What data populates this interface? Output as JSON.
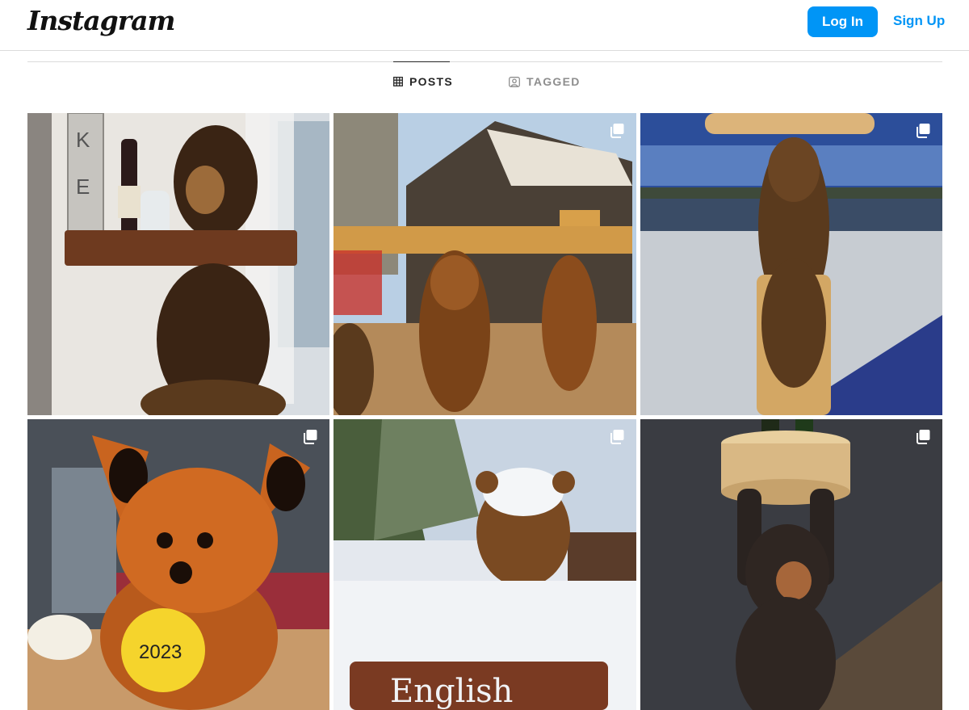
{
  "header": {
    "logo_text": "Instagram",
    "login_label": "Log In",
    "signup_label": "Sign Up",
    "accent_color": "#0095f6"
  },
  "tabs": [
    {
      "label": "POSTS",
      "icon": "grid-icon",
      "active": true
    },
    {
      "label": "TAGGED",
      "icon": "tagged-person-icon",
      "active": false
    }
  ],
  "posts": [
    {
      "subject": "carved bear holding wooden shelf with wine bottle",
      "multi": false,
      "wall_text": "AKE"
    },
    {
      "subject": "two carved bears supporting a log bar counter",
      "multi": true
    },
    {
      "subject": "carved bear on post holding moose-shaped sign by frozen lake",
      "multi": true
    },
    {
      "subject": "carved fox holding yellow 2023 volleyball",
      "multi": true,
      "ball_text": "2023"
    },
    {
      "subject": "snow covered carved bear above sign",
      "multi": true,
      "sign_text": "English"
    },
    {
      "subject": "carved bear holding log table with wine bottles",
      "multi": true
    }
  ]
}
